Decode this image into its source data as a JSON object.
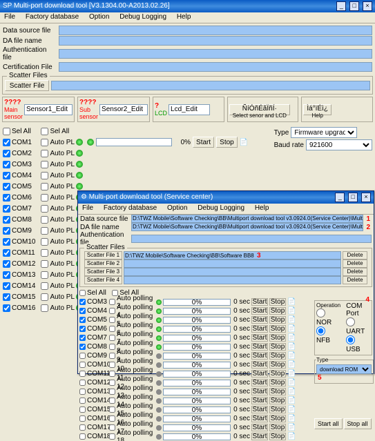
{
  "main_win": {
    "title": "SP Multi-port download tool [V3.1304.00-A2013.02.26]",
    "menu": [
      "File",
      "Factory database",
      "Option",
      "Debug Logging",
      "Help"
    ],
    "files": {
      "data_source": "Data source file",
      "da": "DA file name",
      "auth": "Authentication file",
      "cert": "Certification File"
    },
    "scatter": {
      "legend": "Scatter Files",
      "btn": "Scatter File"
    },
    "sensors": {
      "main_q": "????",
      "main_lbl": "Main sensor",
      "main_val": "Sensor1_Edit",
      "sub_q": "????",
      "sub_lbl": "Sub sensor",
      "sub_val": "Sensor2_Edit",
      "lcd_q": "?",
      "lcd_lbl": "LCD",
      "lcd_val": "Lcd_Edit",
      "sel_btn": "ÑíÓñÉãÏñÍ·",
      "sel_sub": "Select senor and LCD",
      "help_btn": "Ìá°ïÉì¿",
      "help_sub": "Help"
    },
    "sel_all": "Sel All",
    "coms": [
      {
        "c": "COM1",
        "a": "Auto PL",
        "on": true
      },
      {
        "c": "COM2",
        "a": "Auto PL",
        "on": true
      },
      {
        "c": "COM3",
        "a": "Auto PL",
        "on": true
      },
      {
        "c": "COM4",
        "a": "Auto PL",
        "on": true
      },
      {
        "c": "COM5",
        "a": "Auto PL",
        "on": true
      },
      {
        "c": "COM6",
        "a": "Auto PL",
        "on": true
      },
      {
        "c": "COM7",
        "a": "Auto PL",
        "on": true
      },
      {
        "c": "COM8",
        "a": "Auto PL",
        "on": true
      },
      {
        "c": "COM9",
        "a": "Auto PL",
        "on": true
      },
      {
        "c": "COM10",
        "a": "Auto PL",
        "on": true
      },
      {
        "c": "COM11",
        "a": "Auto PL",
        "on": true
      },
      {
        "c": "COM12",
        "a": "Auto PL",
        "on": true
      },
      {
        "c": "COM13",
        "a": "Auto PL",
        "on": true
      },
      {
        "c": "COM14",
        "a": "Auto PL",
        "on": true
      },
      {
        "c": "COM15",
        "a": "Auto PL",
        "on": true
      },
      {
        "c": "COM16",
        "a": "Auto PL",
        "on": true
      }
    ],
    "first": {
      "pct": "0%",
      "start": "Start",
      "stop": "Stop"
    },
    "type": {
      "lbl": "Type",
      "val": "Firmware upgrade"
    },
    "baud": {
      "lbl": "Baud rate",
      "val": "921600"
    }
  },
  "ol": {
    "title": "Multi-port download tool (Service center)",
    "menu": [
      "File",
      "Factory database",
      "Option",
      "Debug Logging",
      "Help"
    ],
    "ds": {
      "lbl": "Data source file",
      "val": "D:\\TWZ Mobile\\Software Checking\\BB\\Multiport download tool v3.0924.0(Service Center)\\Multiport download tool"
    },
    "da": {
      "lbl": "DA file name",
      "val": "D:\\TWZ Mobile\\Software Checking\\BB\\Multiport download tool v3.0924.0(Service Center)\\Multiport download tool"
    },
    "au": {
      "lbl": "Authentication file"
    },
    "scatter_legend": "Scatter Files",
    "scatters": [
      {
        "n": "Scatter File 1",
        "v": "D:\\TWZ Mobile\\Software Checking\\BB\\Software BB8",
        "num": "3"
      },
      {
        "n": "Scatter File 2",
        "v": ""
      },
      {
        "n": "Scatter File 3",
        "v": ""
      },
      {
        "n": "Scatter File 4",
        "v": ""
      }
    ],
    "sel_all": "Sel All",
    "del": "Delete",
    "polls": [
      {
        "c": "COM3",
        "a": "Auto polling 3",
        "g": true,
        "k": true
      },
      {
        "c": "COM4",
        "a": "Auto polling 4",
        "g": true,
        "k": true
      },
      {
        "c": "COM5",
        "a": "Auto polling 5",
        "g": true,
        "k": true
      },
      {
        "c": "COM6",
        "a": "Auto polling 6",
        "g": true,
        "k": true
      },
      {
        "c": "COM7",
        "a": "Auto polling 7",
        "g": true,
        "k": true
      },
      {
        "c": "COM8",
        "a": "Auto polling 8",
        "g": true,
        "k": true
      },
      {
        "c": "COM9",
        "a": "Auto polling 9",
        "g": false,
        "k": false
      },
      {
        "c": "COM10",
        "a": "Auto polling 10",
        "g": false,
        "k": false
      },
      {
        "c": "COM11",
        "a": "Auto polling 11",
        "g": false,
        "k": false
      },
      {
        "c": "COM12",
        "a": "Auto polling 12",
        "g": false,
        "k": false
      },
      {
        "c": "COM13",
        "a": "Auto polling 13",
        "g": false,
        "k": false
      },
      {
        "c": "COM14",
        "a": "Auto polling 14",
        "g": false,
        "k": false
      },
      {
        "c": "COM15",
        "a": "Auto polling 15",
        "g": false,
        "k": false
      },
      {
        "c": "COM16",
        "a": "Auto polling 16",
        "g": false,
        "k": false
      },
      {
        "c": "COM17",
        "a": "Auto polling 17",
        "g": false,
        "k": false
      },
      {
        "c": "COM18",
        "a": "Auto polling 18",
        "g": false,
        "k": false
      }
    ],
    "pct": "0%",
    "sec": "0 sec",
    "start": "Start",
    "stop": "Stop",
    "op": {
      "lbl": "Operation",
      "nor": "NOR",
      "nfb": "NFB"
    },
    "cp": {
      "lbl": "COM Port",
      "uart": "UART",
      "usb": "USB"
    },
    "type_lbl": "Type",
    "type_val": "download ROM",
    "start_all": "Start all",
    "stop_all": "Stop all",
    "n1": "1",
    "n2": "2",
    "n4": "4",
    "n5": "5"
  }
}
